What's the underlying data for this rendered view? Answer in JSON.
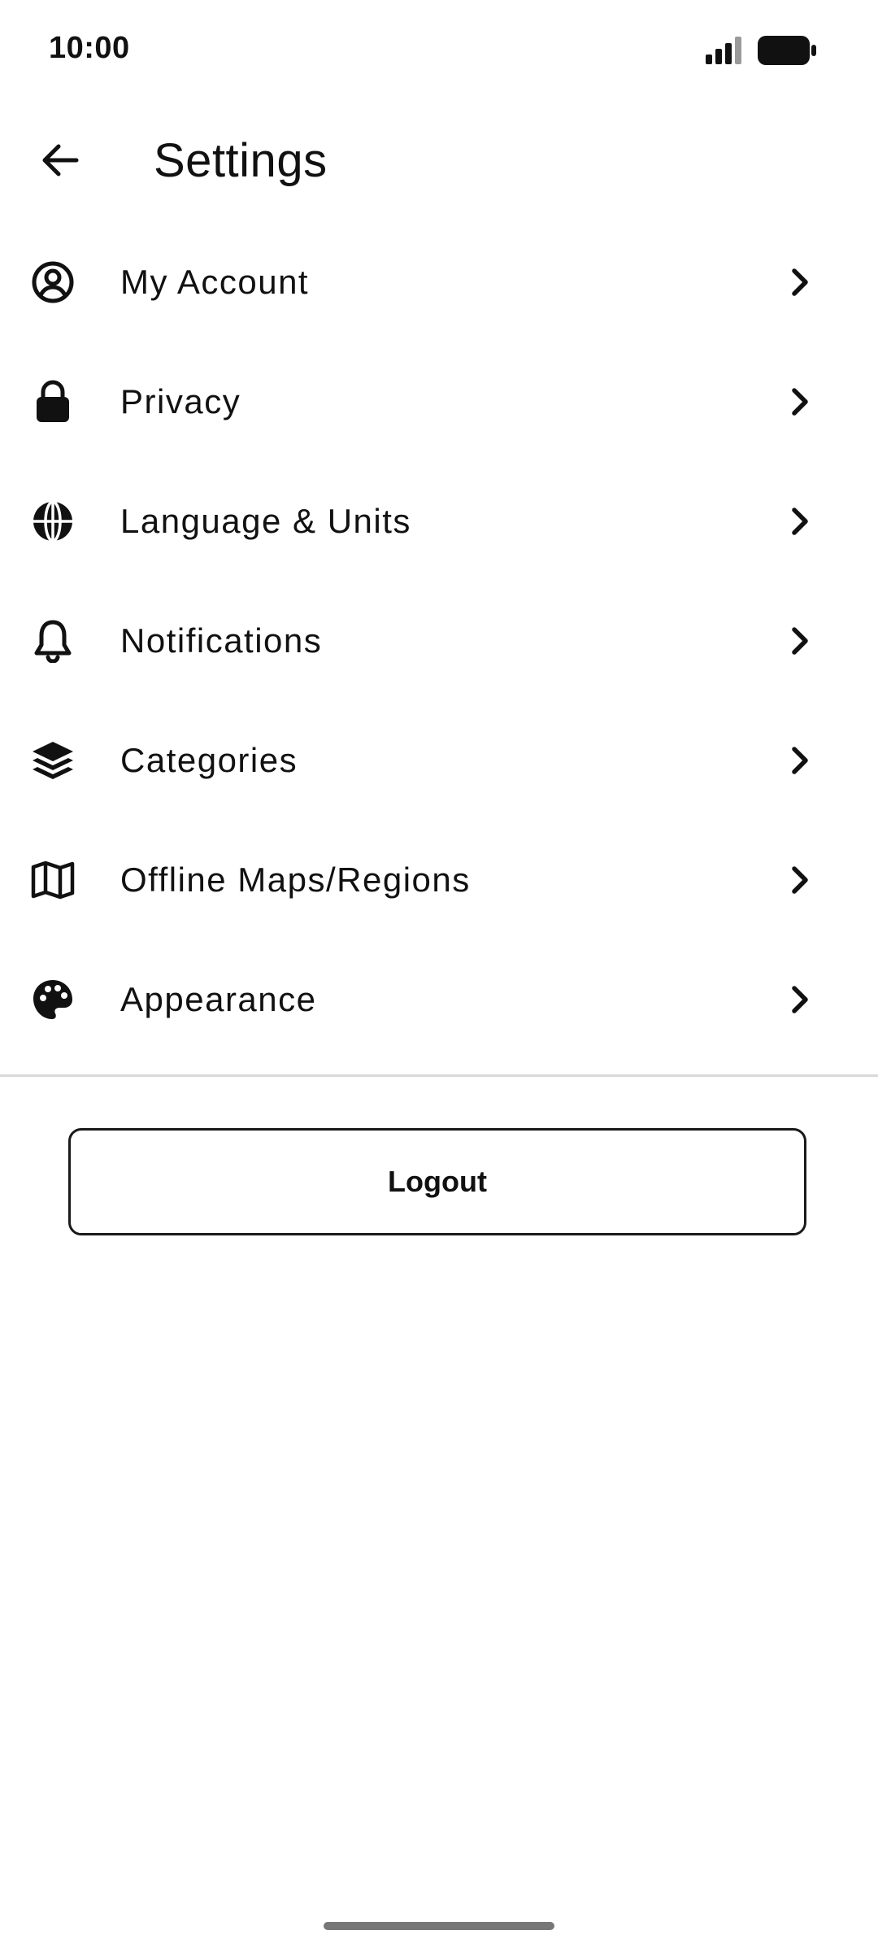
{
  "status_bar": {
    "time": "10:00"
  },
  "header": {
    "title": "Settings"
  },
  "menu": {
    "items": [
      {
        "label": "My Account",
        "icon": "user-circle-icon"
      },
      {
        "label": "Privacy",
        "icon": "lock-icon"
      },
      {
        "label": "Language & Units",
        "icon": "globe-icon"
      },
      {
        "label": "Notifications",
        "icon": "bell-icon"
      },
      {
        "label": "Categories",
        "icon": "layers-icon"
      },
      {
        "label": "Offline Maps/Regions",
        "icon": "map-icon"
      },
      {
        "label": "Appearance",
        "icon": "palette-icon"
      }
    ]
  },
  "logout": {
    "label": "Logout"
  },
  "colors": {
    "text": "#111111",
    "divider": "#d9d9d9",
    "home_indicator": "#777777",
    "background": "#ffffff"
  }
}
